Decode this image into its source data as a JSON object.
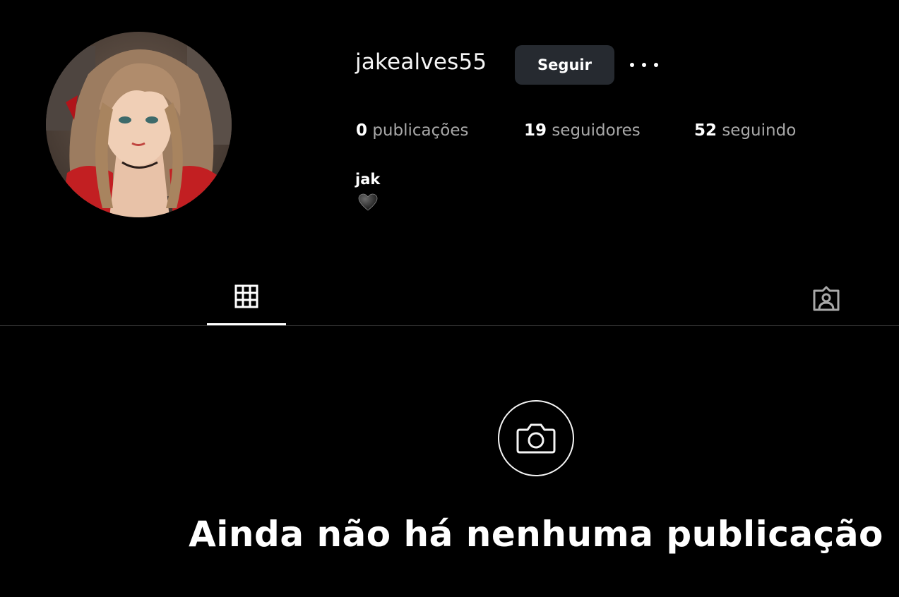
{
  "profile": {
    "username": "jakealves55",
    "follow_label": "Seguir",
    "more_options": "more-horizontal-icon",
    "full_name": "jak",
    "bio_emoji": "🖤"
  },
  "stats": {
    "posts_count": "0",
    "posts_label": "publicações",
    "followers_count": "19",
    "followers_label": "seguidores",
    "following_count": "52",
    "following_label": "seguindo"
  },
  "tabs": {
    "posts_icon": "grid-icon",
    "tagged_icon": "tagged-person-icon",
    "active": "posts"
  },
  "empty_state": {
    "icon": "camera-icon",
    "title": "Ainda não há nenhuma publicação"
  },
  "colors": {
    "background": "#000000",
    "button_bg": "#262a30",
    "secondary_text": "#a8a8a8",
    "divider": "#363636"
  }
}
